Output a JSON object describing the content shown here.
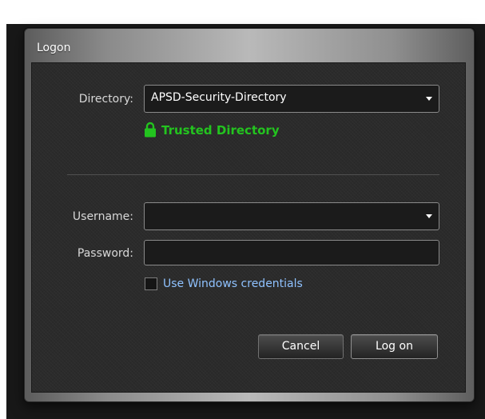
{
  "dialog": {
    "title": "Logon"
  },
  "directory": {
    "label": "Directory:",
    "value": "APSD-Security-Directory",
    "status_text": "Trusted Directory",
    "status_icon": "lock-icon",
    "status_color": "#23c41f"
  },
  "username": {
    "label": "Username:",
    "value": ""
  },
  "password": {
    "label": "Password:",
    "value": ""
  },
  "windows_credentials": {
    "label": "Use Windows credentials",
    "checked": false,
    "label_color": "#8fc2ff"
  },
  "buttons": {
    "cancel_label": "Cancel",
    "logon_label": "Log on"
  }
}
